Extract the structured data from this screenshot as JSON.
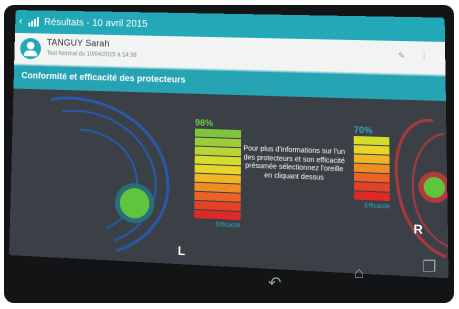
{
  "appbar": {
    "back_icon": "chevron-left-icon",
    "title": "Résultats - 10 avril 2015"
  },
  "patient": {
    "name": "TANGUY Sarah",
    "subtitle": "Test Normal du 10/04/2015 à 14:38"
  },
  "section": {
    "title": "Conformité et efficacité des protecteurs"
  },
  "left_ear": {
    "percent": "98%",
    "efficiency_label": "Efficacité",
    "letter": "L",
    "bar_colors": [
      "#7fc340",
      "#9ccc3c",
      "#b9d535",
      "#d6dc2d",
      "#e8d52a",
      "#f0b626",
      "#ef8d24",
      "#ea6225",
      "#e44226",
      "#dd2a28"
    ]
  },
  "right_ear": {
    "percent": "70%",
    "efficiency_label": "Efficacité",
    "letter": "R",
    "bar_colors": [
      "#d6dc2d",
      "#e8d52a",
      "#f0b626",
      "#ef8d24",
      "#ea6225",
      "#e44226",
      "#dd2a28"
    ]
  },
  "info_text": "Pour plus d'informations sur l'un des protecteurs et son efficacité présumée sélectionnez l'oreille en cliquant dessus",
  "nav": {
    "back_icon": "back-arrow-icon",
    "home_icon": "home-icon",
    "recents_icon": "recents-icon"
  }
}
